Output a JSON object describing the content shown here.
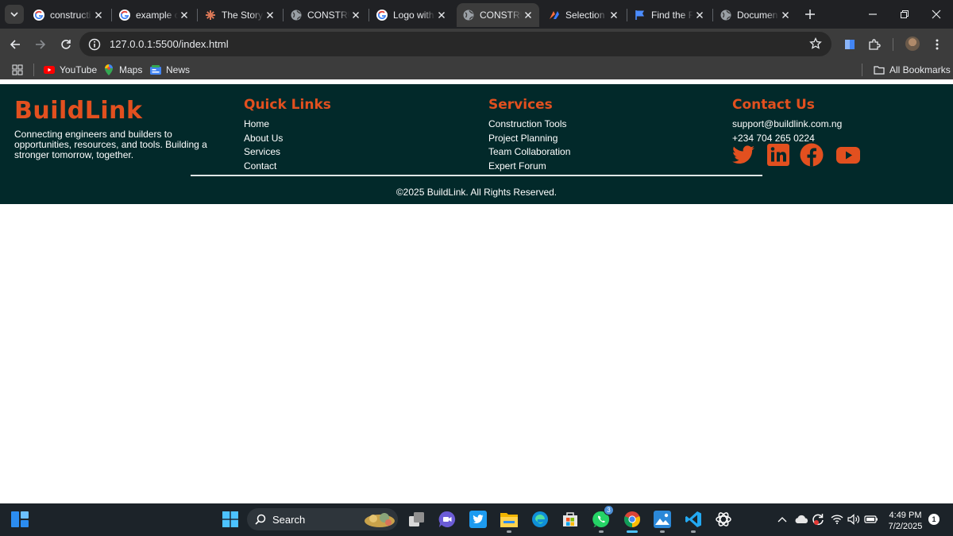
{
  "browser": {
    "tabs": [
      {
        "title": "constructi",
        "icon": "google-icon",
        "active": false
      },
      {
        "title": "example c",
        "icon": "google-icon",
        "active": false
      },
      {
        "title": "The Story",
        "icon": "claude-icon",
        "active": false
      },
      {
        "title": "CONSTRU",
        "icon": "globe-icon",
        "active": false
      },
      {
        "title": "Logo with",
        "icon": "google-icon",
        "active": false
      },
      {
        "title": "CONSTRU",
        "icon": "globe-icon",
        "active": true
      },
      {
        "title": "Selection",
        "icon": "app-icon",
        "active": false
      },
      {
        "title": "Find the F",
        "icon": "flag-icon",
        "active": false
      },
      {
        "title": "Documen",
        "icon": "globe-icon",
        "active": false
      }
    ],
    "url": "127.0.0.1:5500/index.html",
    "bookmarks": [
      {
        "label": "YouTube",
        "icon": "youtube-icon"
      },
      {
        "label": "Maps",
        "icon": "maps-icon"
      },
      {
        "label": "News",
        "icon": "news-icon"
      }
    ],
    "all_bookmarks": "All Bookmarks"
  },
  "site": {
    "brand": "BuildLink",
    "tagline": "Connecting engineers and builders to opportunities, resources, and tools. Building a stronger tomorrow, together.",
    "quick_links": {
      "title": "Quick Links",
      "items": [
        "Home",
        "About Us",
        "Services",
        "Contact"
      ]
    },
    "services": {
      "title": "Services",
      "items": [
        "Construction Tools",
        "Project Planning",
        "Team Collaboration",
        "Expert Forum"
      ]
    },
    "contact": {
      "title": "Contact Us",
      "email": "support@buildlink.com.ng",
      "phone": "+234 704 265 0224",
      "social": [
        "twitter-icon",
        "linkedin-icon",
        "facebook-icon",
        "youtube-icon"
      ]
    },
    "copyright": "©2025 BuildLink. All Rights Reserved.",
    "accent_color": "#e2501f",
    "footer_bg": "#02292a"
  },
  "taskbar": {
    "search_label": "Search",
    "whatsapp_badge": "3",
    "time": "4:49 PM",
    "date": "7/2/2025",
    "notification_count": "1"
  }
}
